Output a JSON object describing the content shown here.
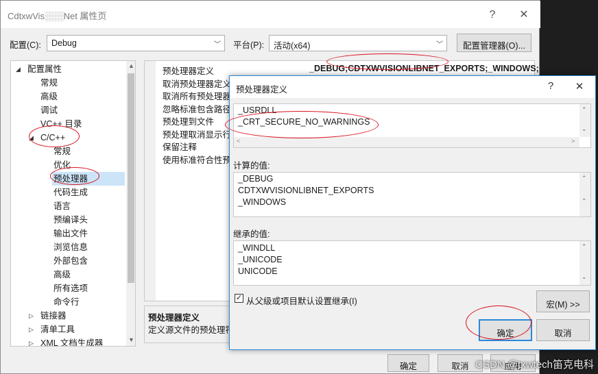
{
  "window": {
    "title": "CdtxwVis░░░Net 属性页",
    "help": "?",
    "close": "✕"
  },
  "toolbar": {
    "config_label": "配置(C):",
    "config_value": "Debug",
    "platform_label": "平台(P):",
    "platform_value": "活动(x64)",
    "config_manager": "配置管理器(O)..."
  },
  "tree": {
    "items": [
      {
        "label": "配置属性",
        "indent": 0,
        "expander": "◢"
      },
      {
        "label": "常规",
        "indent": 1
      },
      {
        "label": "高级",
        "indent": 1
      },
      {
        "label": "调试",
        "indent": 1
      },
      {
        "label": "VC++ 目录",
        "indent": 1
      },
      {
        "label": "C/C++",
        "indent": 1,
        "expander": "◢"
      },
      {
        "label": "常规",
        "indent": 2
      },
      {
        "label": "优化",
        "indent": 2
      },
      {
        "label": "预处理器",
        "indent": 2,
        "selected": true
      },
      {
        "label": "代码生成",
        "indent": 2
      },
      {
        "label": "语言",
        "indent": 2
      },
      {
        "label": "预编译头",
        "indent": 2
      },
      {
        "label": "输出文件",
        "indent": 2
      },
      {
        "label": "浏览信息",
        "indent": 2
      },
      {
        "label": "外部包含",
        "indent": 2
      },
      {
        "label": "高级",
        "indent": 2
      },
      {
        "label": "所有选项",
        "indent": 2
      },
      {
        "label": "命令行",
        "indent": 2
      },
      {
        "label": "链接器",
        "indent": 1,
        "expander": "▷"
      },
      {
        "label": "清单工具",
        "indent": 1,
        "expander": "▷"
      },
      {
        "label": "XML 文档生成器",
        "indent": 1,
        "expander": "▷"
      }
    ]
  },
  "grid": {
    "props": [
      "预处理器定义",
      "取消预处理器定义",
      "取消所有预处理器定",
      "忽略标准包含路径",
      "预处理到文件",
      "预处理取消显示行",
      "保留注释",
      "使用标准符合性预处"
    ],
    "first_value": "_DEBUG;CDTXWVISIONLIBNET_EXPORTS;_WINDOWS;"
  },
  "description": {
    "title": "预处理器定义",
    "text": "定义源文件的预处理符"
  },
  "main_buttons": {
    "ok": "确定",
    "cancel": "取消",
    "apply": "应用"
  },
  "dialog": {
    "title": "预处理器定义",
    "help": "?",
    "close": "✕",
    "edit_lines": [
      "_USRDLL",
      "_CRT_SECURE_NO_WARNINGS"
    ],
    "computed_label": "计算的值:",
    "computed_lines": [
      "_DEBUG",
      "CDTXWVISIONLIBNET_EXPORTS",
      "_WINDOWS"
    ],
    "inherited_label": "继承的值:",
    "inherited_lines": [
      "_WINDLL",
      "_UNICODE",
      "UNICODE"
    ],
    "inherit_checkbox": "从父级或项目默认设置继承(I)",
    "inherit_checked": true,
    "macro_button": "宏(M) >>",
    "ok": "确定",
    "cancel": "取消"
  },
  "watermark": "CSDN @txwtech笛克电科",
  "colors": {
    "accent": "#2b88d8",
    "selection": "#cce4f7",
    "annotation_red": "#d9121e"
  }
}
